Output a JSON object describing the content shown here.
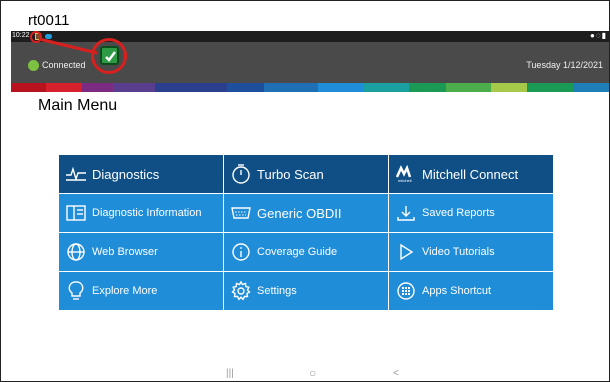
{
  "annotation": {
    "title": "rt0011"
  },
  "status_bar": {
    "time": "10:22"
  },
  "header": {
    "connection_status": "Connected",
    "date": "Tuesday 1/12/2021"
  },
  "colors": {
    "header_bg": "#4a4a4a",
    "connected_green": "#7cc142",
    "tile_dark": "#0f4f86",
    "tile_light": "#1f8dd8",
    "band": [
      "#b8121f",
      "#d6212d",
      "#7c2b83",
      "#5a3e8e",
      "#2b3f8f",
      "#1d4f9d",
      "#1f6fb4",
      "#1f8dd8",
      "#1aa0a0",
      "#1a9a55",
      "#4cae4a",
      "#a6c94a",
      "#1a9a55",
      "#1e7fb8"
    ]
  },
  "main": {
    "title": "Main Menu",
    "tiles": [
      {
        "label": "Diagnostics",
        "icon": "diagnostics-wave-icon",
        "style": "dark",
        "size": "big"
      },
      {
        "label": "Turbo Scan",
        "icon": "stopwatch-icon",
        "style": "dark",
        "size": "big"
      },
      {
        "label": "Mitchell Connect",
        "icon": "mitchell-logo-icon",
        "style": "dark",
        "size": "big"
      },
      {
        "label": "Diagnostic Information",
        "icon": "book-icon",
        "style": "light",
        "size": "small"
      },
      {
        "label": "Generic OBDII",
        "icon": "obd-connector-icon",
        "style": "light",
        "size": "big"
      },
      {
        "label": "Saved Reports",
        "icon": "download-tray-icon",
        "style": "light",
        "size": "small"
      },
      {
        "label": "Web Browser",
        "icon": "globe-icon",
        "style": "light",
        "size": "small"
      },
      {
        "label": "Coverage Guide",
        "icon": "info-circle-icon",
        "style": "light",
        "size": "small"
      },
      {
        "label": "Video Tutorials",
        "icon": "play-triangle-icon",
        "style": "light",
        "size": "small"
      },
      {
        "label": "Explore More",
        "icon": "lightbulb-icon",
        "style": "light",
        "size": "small"
      },
      {
        "label": "Settings",
        "icon": "gear-icon",
        "style": "light",
        "size": "small"
      },
      {
        "label": "Apps Shortcut",
        "icon": "apps-grid-icon",
        "style": "light",
        "size": "small"
      }
    ]
  }
}
